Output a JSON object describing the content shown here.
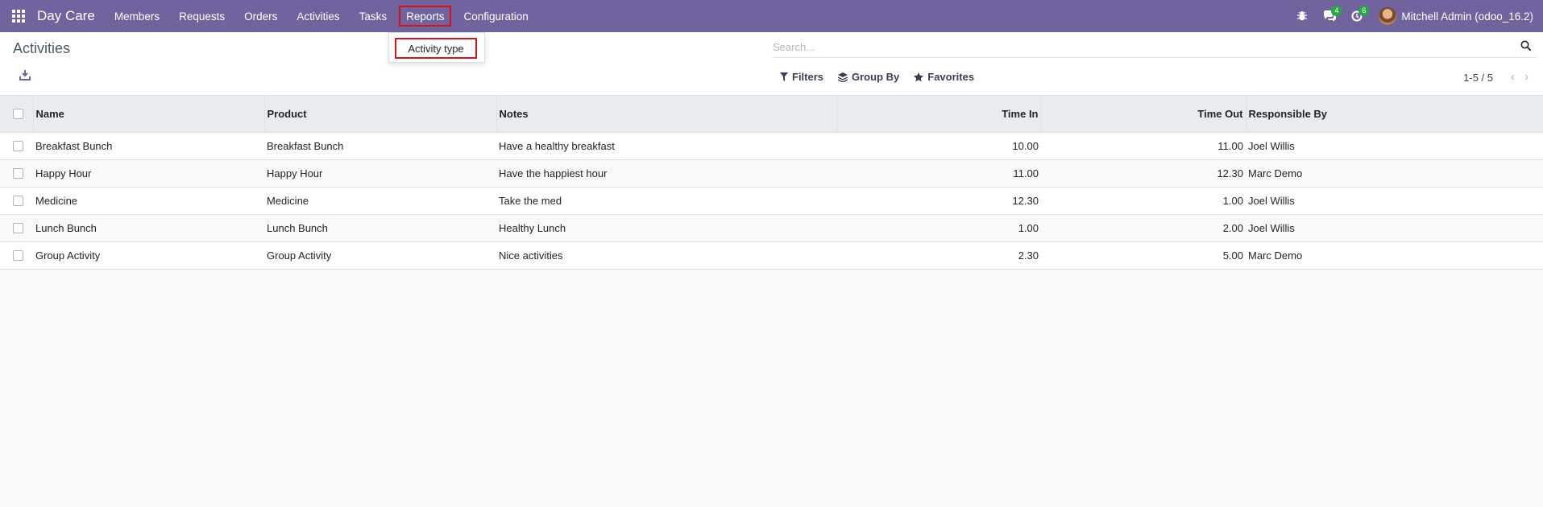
{
  "navbar": {
    "brand": "Day Care",
    "menu": [
      "Members",
      "Requests",
      "Orders",
      "Activities",
      "Tasks",
      "Reports",
      "Configuration"
    ],
    "active_menu": "Reports",
    "chat_count": "4",
    "activity_count": "6",
    "user": "Mitchell Admin (odoo_16.2)"
  },
  "dropdown": {
    "item": "Activity type"
  },
  "control_panel": {
    "title": "Activities",
    "search_placeholder": "Search...",
    "filters_label": "Filters",
    "group_by_label": "Group By",
    "favorites_label": "Favorites",
    "pager": "1-5 / 5"
  },
  "table": {
    "headers": {
      "name": "Name",
      "product": "Product",
      "notes": "Notes",
      "time_in": "Time In",
      "time_out": "Time Out",
      "responsible": "Responsible By"
    },
    "rows": [
      {
        "name": "Breakfast Bunch",
        "product": "Breakfast Bunch",
        "notes": "Have a healthy breakfast",
        "time_in": "10.00",
        "time_out": "11.00",
        "responsible": "Joel Willis"
      },
      {
        "name": "Happy Hour",
        "product": "Happy Hour",
        "notes": "Have the happiest hour",
        "time_in": "11.00",
        "time_out": "12.30",
        "responsible": "Marc Demo"
      },
      {
        "name": "Medicine",
        "product": "Medicine",
        "notes": "Take the med",
        "time_in": "12.30",
        "time_out": "1.00",
        "responsible": "Joel Willis"
      },
      {
        "name": "Lunch Bunch",
        "product": "Lunch Bunch",
        "notes": "Healthy Lunch",
        "time_in": "1.00",
        "time_out": "2.00",
        "responsible": "Joel Willis"
      },
      {
        "name": "Group Activity",
        "product": "Group Activity",
        "notes": "Nice activities",
        "time_in": "2.30",
        "time_out": "5.00",
        "responsible": "Marc Demo"
      }
    ]
  },
  "icons": {
    "apps": "apps-grid-icon",
    "bug": "bug-icon",
    "chat": "chat-icon",
    "clock": "clock-icon",
    "download": "download-icon",
    "search": "search-icon",
    "filter": "filter-icon",
    "group_by": "layers-icon",
    "favorites": "star-icon"
  },
  "colors": {
    "navbar": "#71639e",
    "highlight": "#d0151c",
    "badge": "#28a745"
  }
}
